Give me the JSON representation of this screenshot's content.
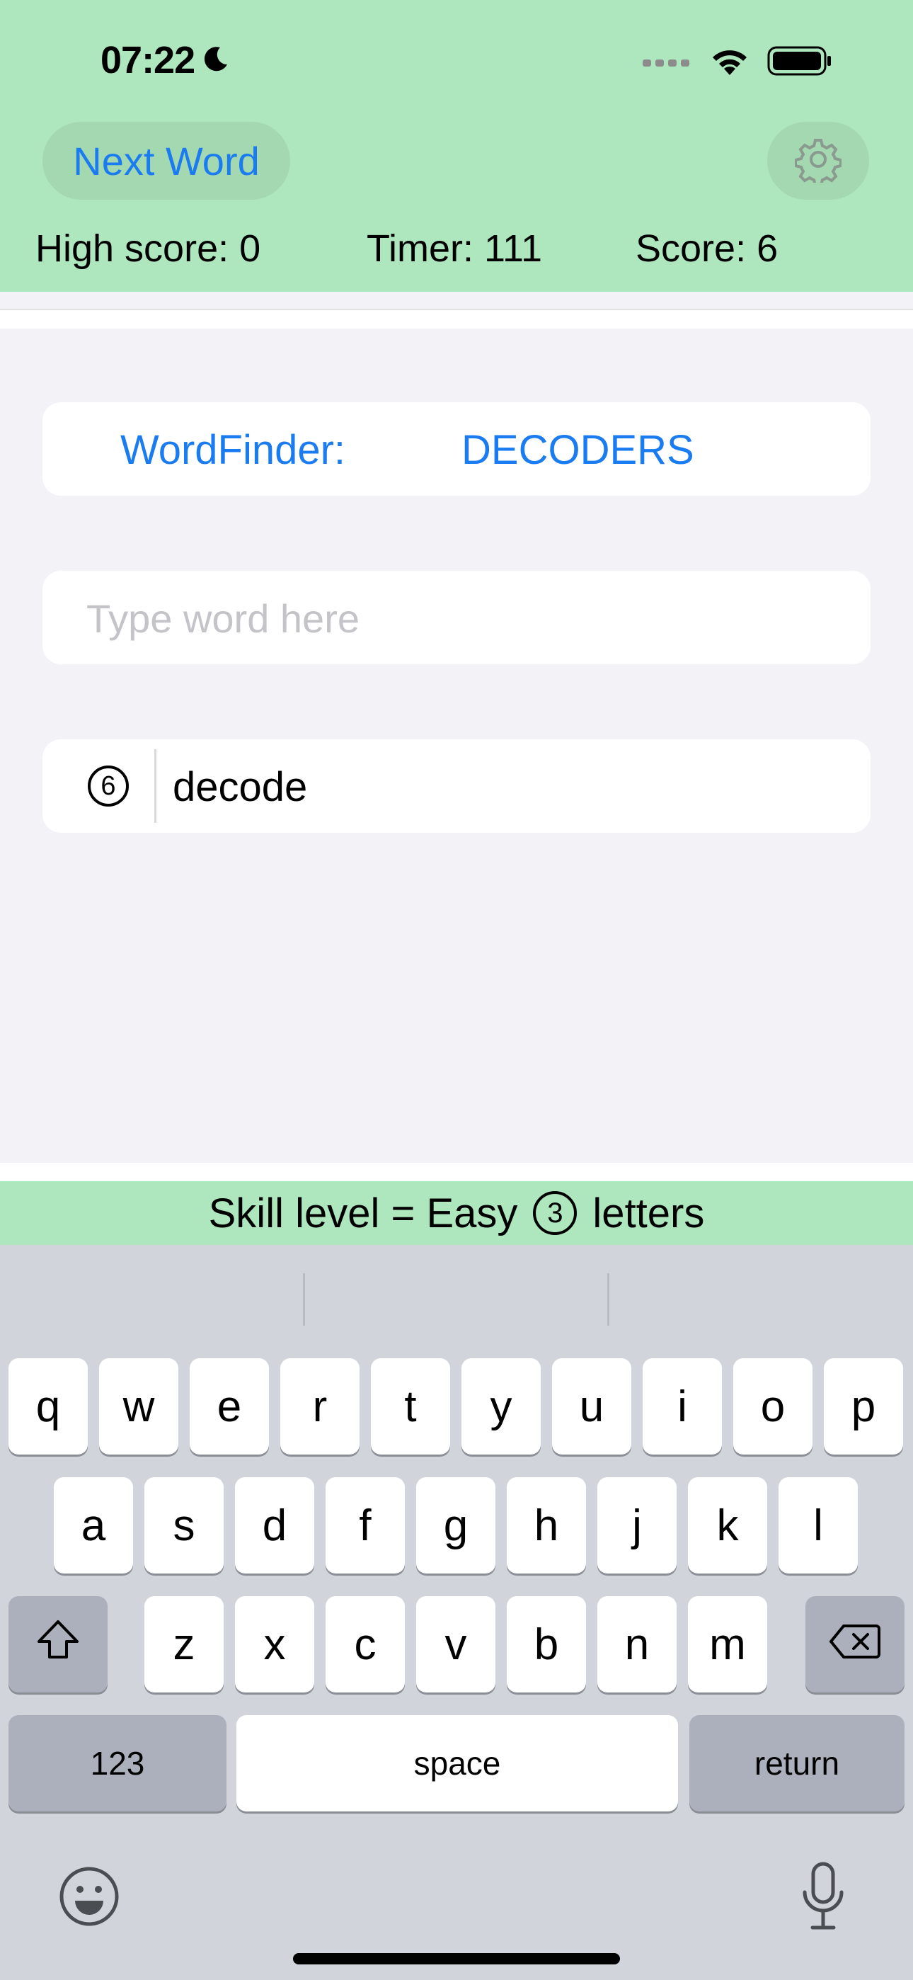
{
  "status_bar": {
    "time": "07:22"
  },
  "header": {
    "next_word_label": "Next Word",
    "high_score": "High score: 0",
    "timer": "Timer: 111",
    "score": "Score: 6"
  },
  "wordfinder": {
    "label": "WordFinder:",
    "word": "DECODERS"
  },
  "input": {
    "placeholder": "Type word here",
    "value": ""
  },
  "found": {
    "count": "6",
    "word": "decode"
  },
  "skill": {
    "prefix": "Skill level = Easy",
    "letters_count": "3",
    "suffix": "letters"
  },
  "keyboard": {
    "row1": [
      "q",
      "w",
      "e",
      "r",
      "t",
      "y",
      "u",
      "i",
      "o",
      "p"
    ],
    "row2": [
      "a",
      "s",
      "d",
      "f",
      "g",
      "h",
      "j",
      "k",
      "l"
    ],
    "row3": [
      "z",
      "x",
      "c",
      "v",
      "b",
      "n",
      "m"
    ],
    "numbers_label": "123",
    "space_label": "space",
    "return_label": "return"
  },
  "colors": {
    "accent": "#1a7cf0",
    "header_bg": "#aee6bd",
    "keyboard_bg": "#d1d4db"
  },
  "icons": [
    "moon-icon",
    "cellular-icon",
    "wifi-icon",
    "battery-icon",
    "gear-icon",
    "shift-icon",
    "delete-icon",
    "emoji-icon",
    "microphone-icon"
  ]
}
